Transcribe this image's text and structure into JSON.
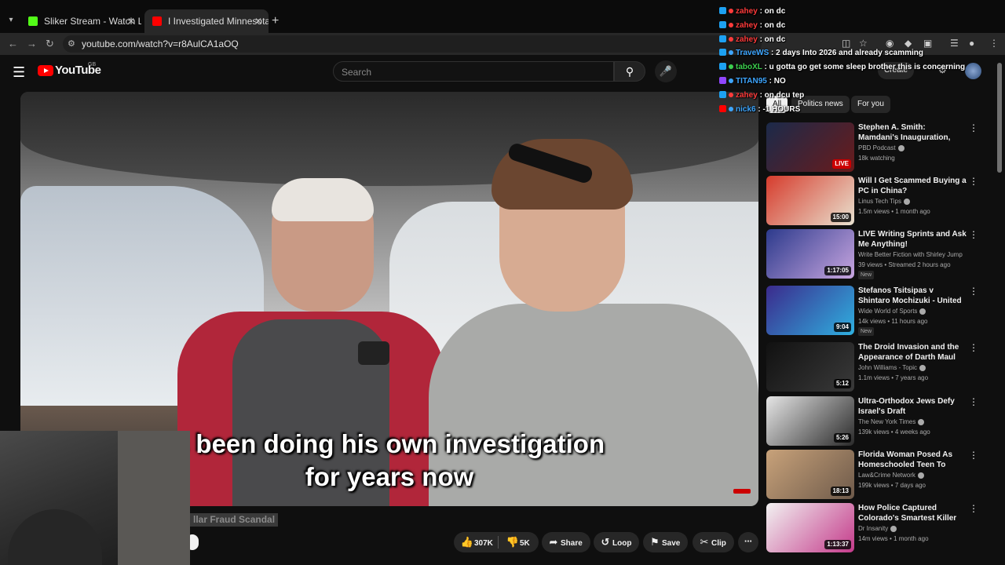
{
  "browser": {
    "tabs": [
      {
        "title": "Sliker Stream - Watch Live on K",
        "favicon_color": "#53fc18"
      },
      {
        "title": "I Investigated Minnesota's Billio",
        "favicon_color": "#ff0000"
      }
    ],
    "new_tab": "+",
    "url": "youtube.com/watch?v=r8AulCA1aOQ"
  },
  "youtube": {
    "logo_text": "YouTube",
    "country": "GB",
    "search_placeholder": "Search",
    "create_label": "Create"
  },
  "video": {
    "subtitle_line1": "s been doing his own investigation",
    "subtitle_line2": "for years now",
    "title_partial": "llar Fraud Scandal"
  },
  "actions": {
    "likes": "307K",
    "dislikes": "5K",
    "share": "Share",
    "loop": "Loop",
    "save": "Save",
    "clip": "Clip"
  },
  "chips": [
    {
      "label": "All",
      "active": true
    },
    {
      "label": "Politics news",
      "active": false
    },
    {
      "label": "For you",
      "active": false
    }
  ],
  "recommendations": [
    {
      "title": "Stephen A. Smith: Mamdani's Inauguration, Minnesota Fraud...",
      "channel": "PBD Podcast",
      "verified": true,
      "meta": "18k watching",
      "duration": "LIVE",
      "live": true,
      "badge": "",
      "thumb_colors": [
        "#1b2a4a",
        "#6a1b1b"
      ]
    },
    {
      "title": "Will I Get Scammed Buying a PC in China?",
      "channel": "Linus Tech Tips",
      "verified": true,
      "meta": "1.5m views • 1 month ago",
      "duration": "15:00",
      "live": false,
      "badge": "",
      "thumb_colors": [
        "#d63b2c",
        "#e9e2d0"
      ]
    },
    {
      "title": "LIVE Writing Sprints and Ask Me Anything!",
      "channel": "Write Better Fiction with Shirley Jump",
      "verified": false,
      "meta": "39 views • Streamed 2 hours ago",
      "duration": "1:17:05",
      "live": false,
      "badge": "New",
      "thumb_colors": [
        "#2c3a8c",
        "#c9a6e0"
      ]
    },
    {
      "title": "Stefanos Tsitsipas v Shintaro Mochizuki - United Cup ...",
      "channel": "Wide World of Sports",
      "verified": true,
      "meta": "14k views • 11 hours ago",
      "duration": "9:04",
      "live": false,
      "badge": "New",
      "thumb_colors": [
        "#3b2a8c",
        "#2fb0e0"
      ]
    },
    {
      "title": "The Droid Invasion and the Appearance of Darth Maul",
      "channel": "John Williams - Topic",
      "verified": true,
      "meta": "1.1m views • 7 years ago",
      "duration": "5:12",
      "live": false,
      "badge": "",
      "thumb_colors": [
        "#111111",
        "#3a3a3a"
      ]
    },
    {
      "title": "Ultra-Orthodox Jews Defy Israel's Draft",
      "channel": "The New York Times",
      "verified": true,
      "meta": "139k views • 4 weeks ago",
      "duration": "5:26",
      "live": false,
      "badge": "",
      "thumb_colors": [
        "#e6e6e6",
        "#2a2a2a"
      ]
    },
    {
      "title": "Florida Woman Posed As Homeschooled Teen To Target...",
      "channel": "Law&Crime Network",
      "verified": true,
      "meta": "199k views • 7 days ago",
      "duration": "18:13",
      "live": false,
      "badge": "",
      "thumb_colors": [
        "#c8a27a",
        "#6e5a4a"
      ]
    },
    {
      "title": "How Police Captured Colorado's Smartest Killer",
      "channel": "Dr Insanity",
      "verified": true,
      "meta": "14m views • 1 month ago",
      "duration": "1:13:37",
      "live": false,
      "badge": "",
      "thumb_colors": [
        "#f2f2f2",
        "#c43a8a"
      ]
    }
  ],
  "chat": [
    {
      "user": "zahey",
      "message": ": on dc",
      "user_color": "#ff3b3b",
      "platform_color": "#1da1f2"
    },
    {
      "user": "zahey",
      "message": ": on dc",
      "user_color": "#ff3b3b",
      "platform_color": "#1da1f2"
    },
    {
      "user": "zahey",
      "message": ": on dc",
      "user_color": "#ff3b3b",
      "platform_color": "#1da1f2"
    },
    {
      "user": "TraveWS",
      "message": ": 2 days Into 2026 and already scamming",
      "user_color": "#3ea6ff",
      "platform_color": "#1da1f2"
    },
    {
      "user": "taboXL",
      "message": ": u gotta go get some sleep brother this is concerning",
      "user_color": "#3ccf4e",
      "platform_color": "#1da1f2"
    },
    {
      "user": "TITAN95",
      "message": ": NO",
      "user_color": "#3ea6ff",
      "platform_color": "#9146ff"
    },
    {
      "user": "zahey",
      "message": ": on dcu tep",
      "user_color": "#ff3b3b",
      "platform_color": "#1da1f2"
    },
    {
      "user": "nick6",
      "message": ": -1 HOURS",
      "user_color": "#3ea6ff",
      "platform_color": "#ff0000"
    }
  ]
}
